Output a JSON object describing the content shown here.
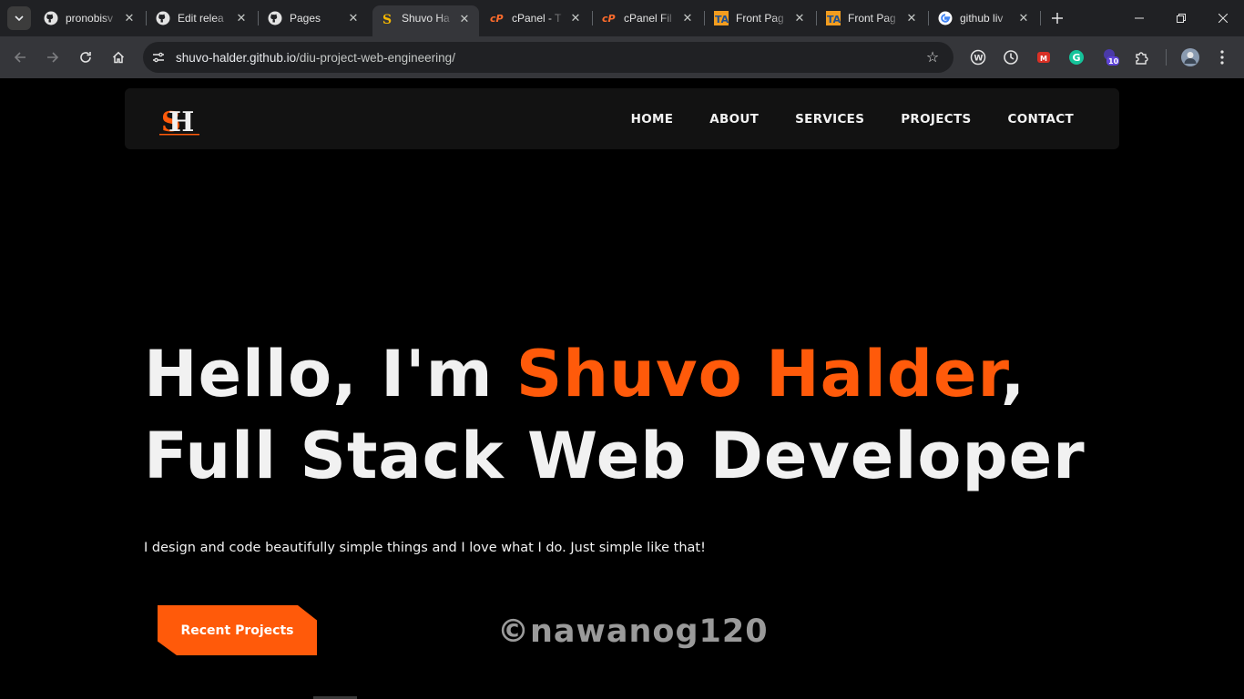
{
  "browser": {
    "tabs": [
      {
        "title": "pronobisv",
        "icon": "github-icon",
        "active": false
      },
      {
        "title": "Edit relea",
        "icon": "github-icon",
        "active": false
      },
      {
        "title": "Pages",
        "icon": "github-icon",
        "active": false
      },
      {
        "title": "Shuvo Ha",
        "icon": "site-s-icon",
        "active": true
      },
      {
        "title": "cPanel - T",
        "icon": "cpanel-icon",
        "active": false
      },
      {
        "title": "cPanel Fil",
        "icon": "cpanel-icon",
        "active": false
      },
      {
        "title": "Front Pag",
        "icon": "ta-icon",
        "active": false
      },
      {
        "title": "Front Pag",
        "icon": "ta-icon",
        "active": false
      },
      {
        "title": "github liv",
        "icon": "google-icon",
        "active": false
      }
    ],
    "url": {
      "host": "shuvo-halder.github.io",
      "path": "/diu-project-web-engineering/"
    },
    "extension_badge": "10",
    "colors": {
      "tabstrip": "#202124",
      "toolbar": "#35363a",
      "omnibox": "#202124"
    }
  },
  "site": {
    "nav": {
      "items": [
        "HOME",
        "ABOUT",
        "SERVICES",
        "PROJECTS",
        "CONTACT"
      ]
    },
    "hero": {
      "greeting": "Hello, I'm ",
      "name": "Shuvo Halder",
      "comma": ",",
      "role": "Full Stack Web Developer",
      "tagline": "I design and code beautifully simple things and I love what I do. Just simple like that!",
      "cta_label": "Recent Projects"
    },
    "watermark": "©nawanog120",
    "colors": {
      "accent": "#ff5a0a",
      "nav_bg": "#121212",
      "page_bg": "#000000",
      "text": "#f1f1f1"
    }
  }
}
